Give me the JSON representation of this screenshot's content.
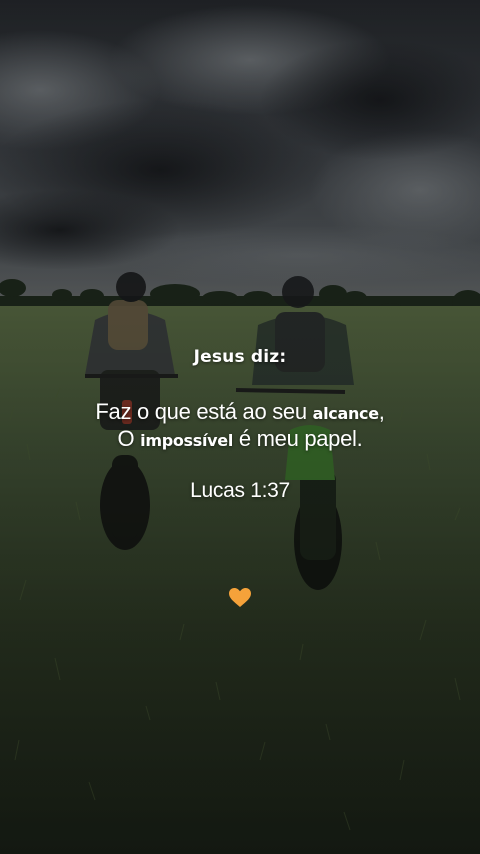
{
  "quote": {
    "title": "Jesus diz:",
    "line1_start": "Faz o que está ao seu ",
    "line1_bold": "alcance",
    "line1_end": ",",
    "line2_start": "O ",
    "line2_bold": "impossível",
    "line2_end": " é meu papel.",
    "reference": "Lucas 1:37"
  },
  "heart_icon": "orange-heart-icon",
  "colors": {
    "sky": "#2b2e31",
    "field": "#3a4a2c",
    "text": "#ffffff",
    "heart": "#f5a23a"
  }
}
